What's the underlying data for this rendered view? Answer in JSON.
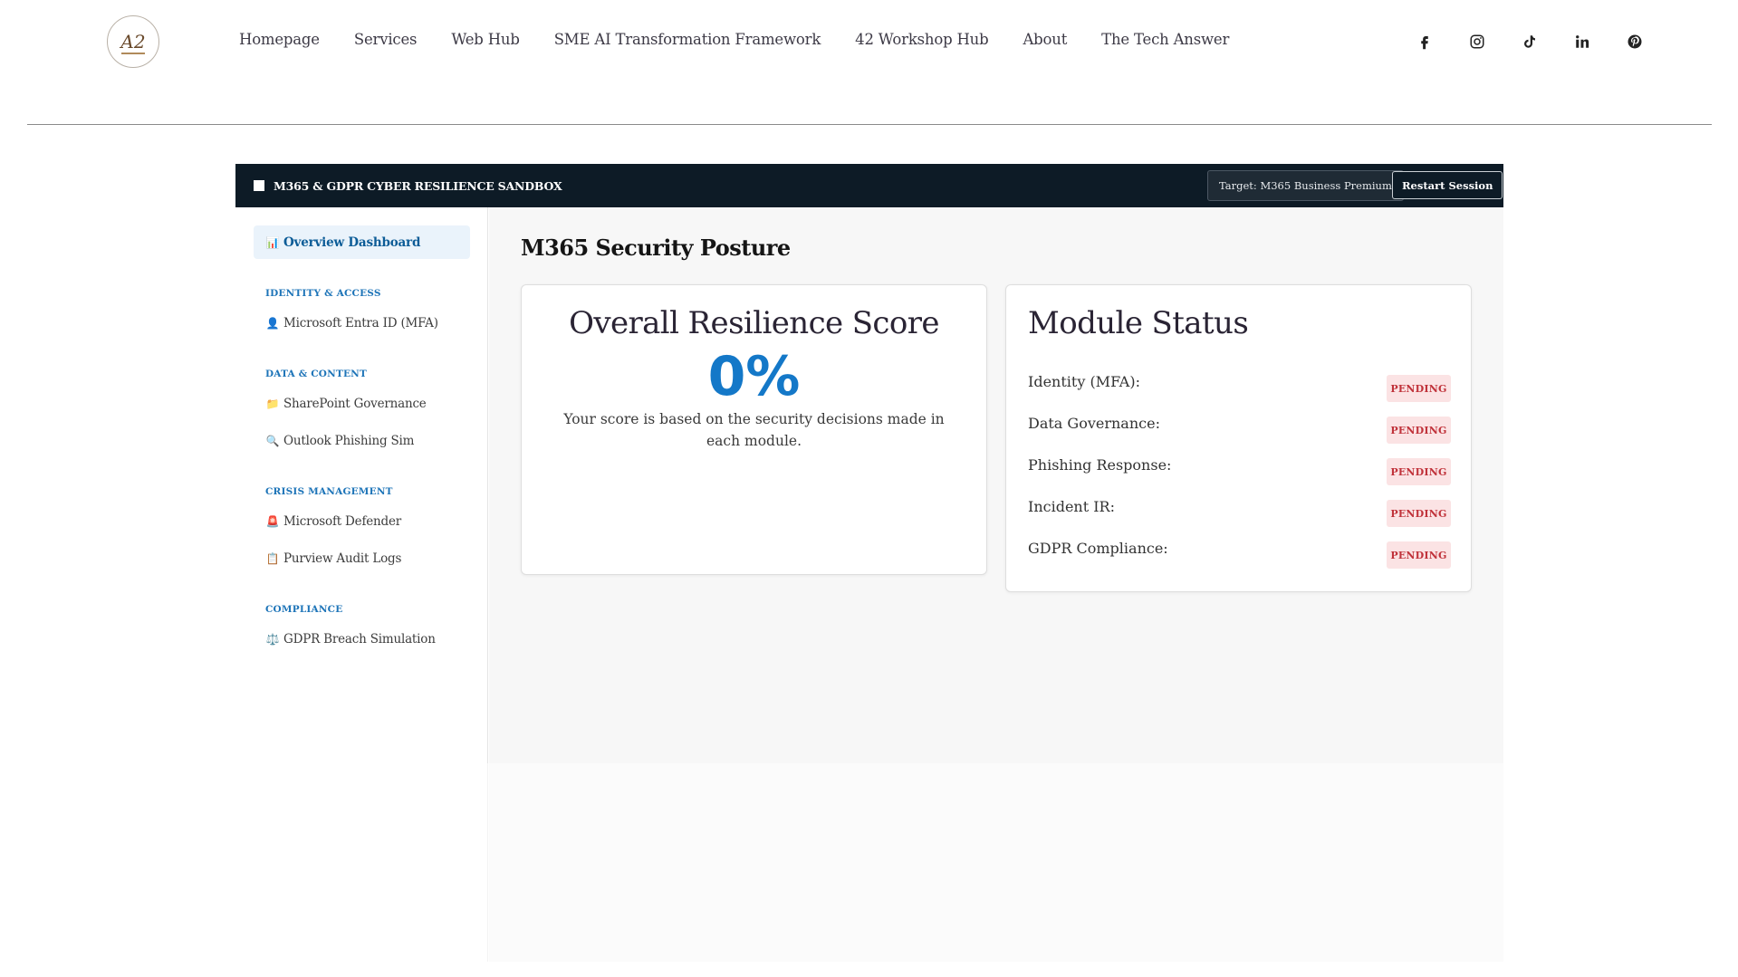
{
  "site": {
    "nav": [
      "Homepage",
      "Services",
      "Web Hub",
      "SME AI Transformation Framework",
      "42 Workshop Hub",
      "About",
      "The Tech Answer"
    ],
    "social_icons": [
      "facebook-icon",
      "instagram-icon",
      "tiktok-icon",
      "linkedin-icon",
      "pinterest-icon"
    ]
  },
  "app": {
    "title": "M365 & GDPR CYBER RESILIENCE SANDBOX",
    "target_label": "Target: M365 Business Premium",
    "restart_label": "Restart Session"
  },
  "sidebar": {
    "overview": {
      "icon": "📊",
      "label": "Overview Dashboard"
    },
    "sections": [
      {
        "heading": "IDENTITY & ACCESS",
        "items": [
          {
            "icon": "👤",
            "label": "Microsoft Entra ID (MFA)"
          }
        ]
      },
      {
        "heading": "DATA & CONTENT",
        "items": [
          {
            "icon": "📁",
            "label": "SharePoint Governance"
          },
          {
            "icon": "🔍",
            "label": "Outlook Phishing Sim"
          }
        ]
      },
      {
        "heading": "CRISIS MANAGEMENT",
        "items": [
          {
            "icon": "🚨",
            "label": "Microsoft Defender"
          },
          {
            "icon": "📋",
            "label": "Purview Audit Logs"
          }
        ]
      },
      {
        "heading": "COMPLIANCE",
        "items": [
          {
            "icon": "⚖️",
            "label": "GDPR Breach Simulation"
          }
        ]
      }
    ]
  },
  "main": {
    "title": "M365 Security Posture",
    "score": {
      "title": "Overall Resilience Score",
      "value": "0%",
      "description": "Your score is based on the security decisions made in each module."
    },
    "status": {
      "title": "Module Status",
      "rows": [
        {
          "label": "Identity (MFA):",
          "status": "PENDING"
        },
        {
          "label": "Data Governance:",
          "status": "PENDING"
        },
        {
          "label": "Phishing Response:",
          "status": "PENDING"
        },
        {
          "label": "Incident IR:",
          "status": "PENDING"
        },
        {
          "label": "GDPR Compliance:",
          "status": "PENDING"
        }
      ]
    }
  },
  "colors": {
    "accent": "#1478c8",
    "topbar": "#0d1b26",
    "pending_bg": "#fbe3e4",
    "pending_text": "#c0323a"
  }
}
